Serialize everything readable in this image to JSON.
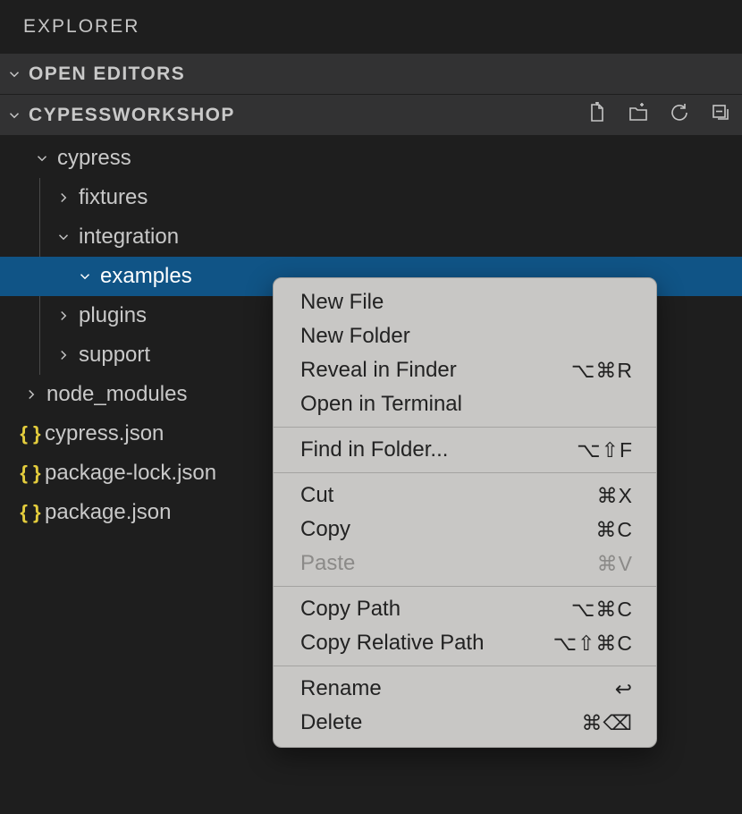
{
  "header": {
    "title": "EXPLORER"
  },
  "sections": {
    "openEditors": {
      "label": "OPEN EDITORS"
    },
    "project": {
      "label": "CYPESSWORKSHOP"
    }
  },
  "tree": {
    "cypress": "cypress",
    "fixtures": "fixtures",
    "integration": "integration",
    "examples": "examples",
    "plugins": "plugins",
    "support": "support",
    "node_modules": "node_modules",
    "cypress_json": "cypress.json",
    "package_lock_json": "package-lock.json",
    "package_json": "package.json"
  },
  "icons": {
    "json": "{ }"
  },
  "menu": {
    "newFile": "New File",
    "newFolder": "New Folder",
    "revealFinder": "Reveal in Finder",
    "revealFinderKey": "⌥⌘R",
    "openTerminal": "Open in Terminal",
    "findFolder": "Find in Folder...",
    "findFolderKey": "⌥⇧F",
    "cut": "Cut",
    "cutKey": "⌘X",
    "copy": "Copy",
    "copyKey": "⌘C",
    "paste": "Paste",
    "pasteKey": "⌘V",
    "copyPath": "Copy Path",
    "copyPathKey": "⌥⌘C",
    "copyRelPath": "Copy Relative Path",
    "copyRelPathKey": "⌥⇧⌘C",
    "rename": "Rename",
    "renameKey": "↩",
    "delete": "Delete",
    "deleteKey": "⌘⌫"
  }
}
